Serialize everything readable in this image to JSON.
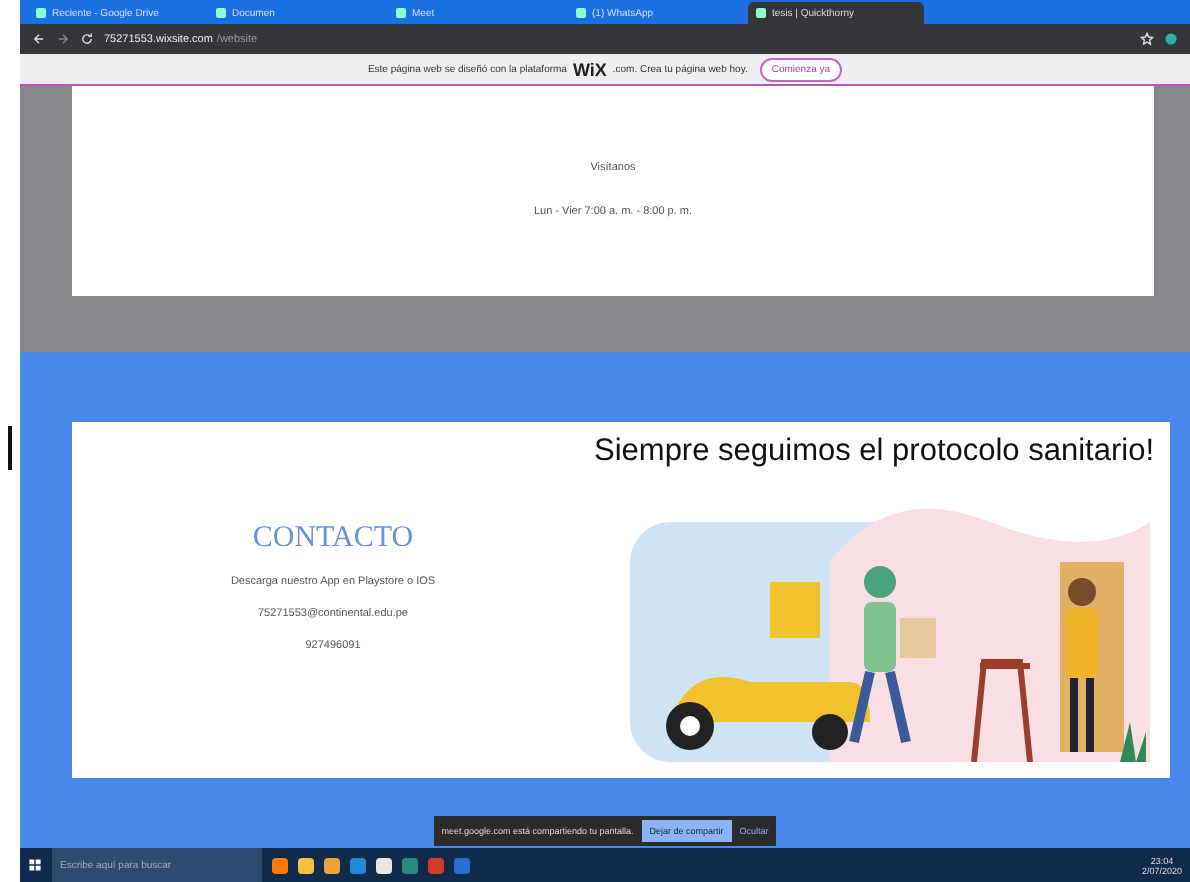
{
  "browser": {
    "tabs": [
      {
        "label": "Reciente - Google Drive",
        "selected": false
      },
      {
        "label": "Documen",
        "selected": false
      },
      {
        "label": "Meet",
        "selected": false
      },
      {
        "label": "(1) WhatsApp",
        "selected": false
      },
      {
        "label": "tesis | Quickthorny",
        "selected": true
      }
    ],
    "url": "75271553.wixsite.com",
    "url_path": "/website"
  },
  "wix_banner": {
    "text": "Este página web se diseñó con la plataforma",
    "logo": "WiX",
    "logo_suffix": ".com. Crea tu página web hoy.",
    "button": "Comienza ya"
  },
  "hours_card": {
    "heading": "Visítanos",
    "hours": "Lun - Vier 7:00 a. m. - 8:00 p. m."
  },
  "contact_card": {
    "title": "CONTACTO",
    "lines": [
      "Descarga nuestro App en Playstore o IOS",
      "75271553@continental.edu.pe",
      "927496091"
    ],
    "banner_title": "Siempre seguimos el protocolo sanitario!"
  },
  "share_bar": {
    "text": "meet.google.com está compartiendo tu pantalla.",
    "stop_button": "Dejar de compartir",
    "hide_button": "Ocultar"
  },
  "taskbar": {
    "search_placeholder": "Escribe aquí para buscar",
    "time": "23:04",
    "date": "2/07/2020"
  }
}
